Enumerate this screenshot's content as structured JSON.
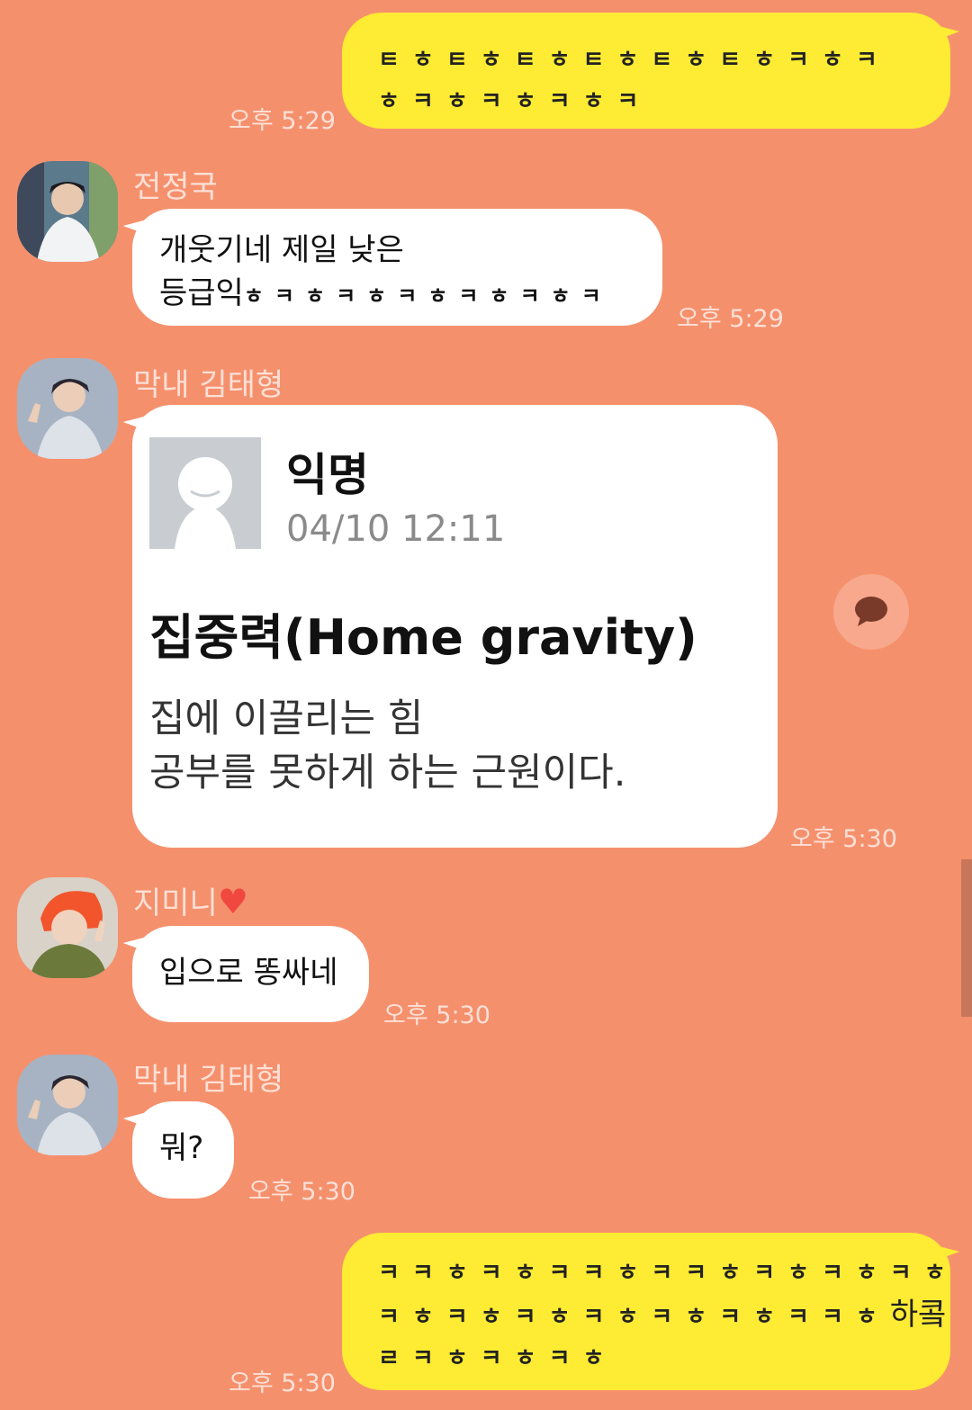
{
  "colors": {
    "background": "#F5906D",
    "my_bubble": "#FEEB33",
    "other_bubble": "#FFFFFF",
    "heart": "#F0483E"
  },
  "messages": {
    "m1": {
      "text": "ㅌㅎㅌㅎㅌㅎㅌㅎㅌㅎㅌㅎㅋㅎㅋㅎㅋㅎㅋㅎㅋㅎㅋ",
      "time": "오후 5:29"
    },
    "m2": {
      "sender": "전정국",
      "text_line1": "개웃기네 제일 낮은",
      "text_line2_prefix": "등급익",
      "text_line2_suffix": "ㅎㅋㅎㅋㅎㅋㅎㅋㅎㅋㅎㅋ",
      "time": "오후 5:29"
    },
    "m3": {
      "sender": "막내 김태형",
      "card": {
        "author": "익명",
        "datetime": "04/10 12:11",
        "headline": "집중력(Home gravity)",
        "body_line1": "집에 이끌리는 힘",
        "body_line2": "공부를 못하게 하는 근원이다."
      },
      "time": "오후 5:30"
    },
    "m4": {
      "sender": "지미니",
      "sender_emoji": "❤️",
      "text": "입으로 똥싸네",
      "time": "오후 5:30"
    },
    "m5": {
      "sender": "막내 김태형",
      "text": "뭐?",
      "time": "오후 5:30"
    },
    "m6": {
      "text_line1": "ㅋㅋㅎㅋㅎㅋㅋㅎㅋㅋㅎㅋㅎㅋㅎㅋㅎ",
      "text_line2_prefix": "ㅋㅎㅋㅎㅋㅎㅋㅎㅋㅎㅋㅎㅋㅋㅎ",
      "text_line2_suffix": "하콬",
      "text_line3": "ㄹㅋㅎㅋㅎㅋㅎ",
      "time": "오후 5:30"
    }
  },
  "icons": {
    "share": "speech-bubble-icon",
    "heart": "heart-icon"
  }
}
